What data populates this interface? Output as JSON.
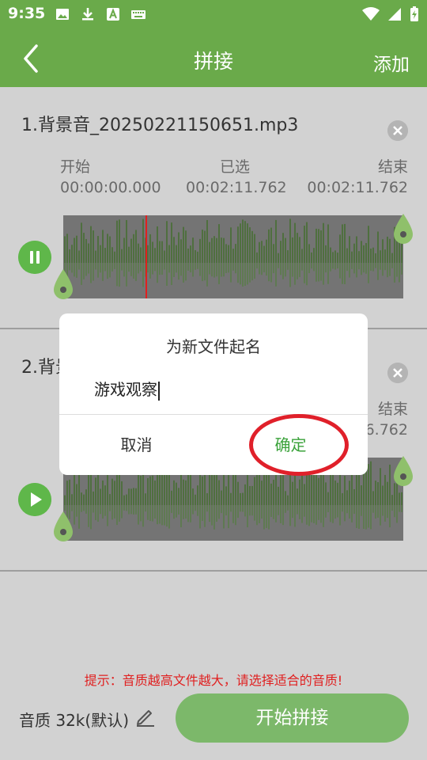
{
  "status": {
    "time": "9:35"
  },
  "appbar": {
    "title": "拼接",
    "add_label": "添加"
  },
  "tracks": [
    {
      "name": "1.背景音_20250221150651.mp3",
      "start_label": "开始",
      "start_time": "00:00:00.000",
      "selected_label": "已选",
      "selected_time": "00:02:11.762",
      "end_label": "结束",
      "end_time": "00:02:11.762",
      "playing": true
    },
    {
      "name": "2.背景",
      "end_label": "结束",
      "end_time": "6.762",
      "playing": false
    }
  ],
  "dialog": {
    "title": "为新文件起名",
    "input_value": "游戏观察",
    "cancel_label": "取消",
    "ok_label": "确定"
  },
  "footer": {
    "hint": "提示：音质越高文件越大，请选择适合的音质!",
    "quality_label": "音质 32k(默认)",
    "start_label": "开始拼接"
  },
  "colors": {
    "primary": "#6aaa4a",
    "accent_red": "#e02020",
    "ok_green": "#3aa23a"
  }
}
